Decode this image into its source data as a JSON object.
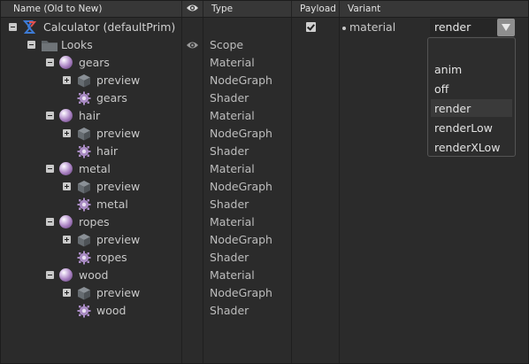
{
  "header": {
    "name_col": "Name (Old to New)",
    "type_col": "Type",
    "payload_col": "Payload",
    "variant_col": "Variant",
    "visibility_icon": "eye-icon"
  },
  "root": {
    "label": "Calculator (defaultPrim)",
    "icon": "usd-prim-icon",
    "payload_checked": true,
    "variant_set": "material",
    "variant_value": "render"
  },
  "looks": {
    "label": "Looks",
    "type": "Scope",
    "icon": "folder-icon",
    "visibility_icon": "eye-icon"
  },
  "materials": [
    {
      "name": "gears",
      "type": "Material",
      "preview": "preview",
      "preview_type": "NodeGraph",
      "shader": "gears",
      "shader_type": "Shader"
    },
    {
      "name": "hair",
      "type": "Material",
      "preview": "preview",
      "preview_type": "NodeGraph",
      "shader": "hair",
      "shader_type": "Shader"
    },
    {
      "name": "metal",
      "type": "Material",
      "preview": "preview",
      "preview_type": "NodeGraph",
      "shader": "metal",
      "shader_type": "Shader"
    },
    {
      "name": "ropes",
      "type": "Material",
      "preview": "preview",
      "preview_type": "NodeGraph",
      "shader": "ropes",
      "shader_type": "Shader"
    },
    {
      "name": "wood",
      "type": "Material",
      "preview": "preview",
      "preview_type": "NodeGraph",
      "shader": "wood",
      "shader_type": "Shader"
    }
  ],
  "variant_options": [
    "",
    "anim",
    "off",
    "render",
    "renderLow",
    "renderXLow"
  ],
  "selected_variant_option": "render",
  "colors": {
    "background": "#2b2b2b",
    "header": "#373737",
    "text": "#c8c8c8",
    "material_sphere": "#a77fc0",
    "shader_gear": "#a98bc4"
  }
}
